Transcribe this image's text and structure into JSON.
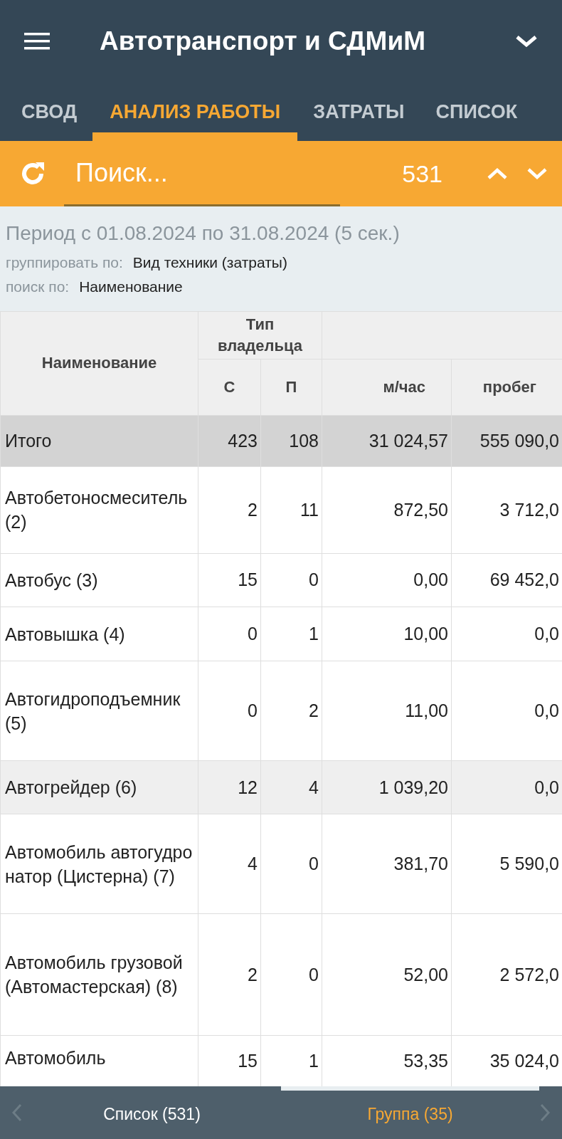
{
  "app_bar": {
    "title": "Автотранспорт и СДМиМ"
  },
  "tabs": [
    {
      "label": "СВОД",
      "selected": false
    },
    {
      "label": "АНАЛИЗ РАБОТЫ",
      "selected": true
    },
    {
      "label": "ЗАТРАТЫ",
      "selected": false
    },
    {
      "label": "СПИСОК",
      "selected": false
    }
  ],
  "search": {
    "placeholder": "Поиск...",
    "count": "531"
  },
  "info": {
    "period": "Период с 01.08.2024 по 31.08.2024 (5 сек.)",
    "group_label": "группировать по:",
    "group_value": "Вид техники (затраты)",
    "search_label": "поиск по:",
    "search_value": "Наименование"
  },
  "table": {
    "header_group": "Тип владельца",
    "columns": [
      "Наименование",
      "С",
      "П",
      "м/час",
      "пробег"
    ],
    "total": {
      "name": "Итого",
      "values": [
        "423",
        "108",
        "31 024,57",
        "555 090,0"
      ]
    },
    "rows": [
      {
        "name": "Автобетоносмеситель (2)",
        "values": [
          "2",
          "11",
          "872,50",
          "3 712,0"
        ],
        "highlighted": false
      },
      {
        "name": "Автобус (3)",
        "values": [
          "15",
          "0",
          "0,00",
          "69 452,0"
        ],
        "highlighted": false
      },
      {
        "name": "Автовышка (4)",
        "values": [
          "0",
          "1",
          "10,00",
          "0,0"
        ],
        "highlighted": false
      },
      {
        "name": "Автогидроподъемник (5)",
        "values": [
          "0",
          "2",
          "11,00",
          "0,0"
        ],
        "highlighted": false
      },
      {
        "name": "Автогрейдер (6)",
        "values": [
          "12",
          "4",
          "1 039,20",
          "0,0"
        ],
        "highlighted": true
      },
      {
        "name": "Автомобиль автогудронатор (Цистерна) (7)",
        "values": [
          "4",
          "0",
          "381,70",
          "5 590,0"
        ],
        "highlighted": false
      },
      {
        "name": "Автомобиль грузовой (Автомастерская) (8)",
        "values": [
          "2",
          "0",
          "52,00",
          "2 572,0"
        ],
        "highlighted": false
      },
      {
        "name": "Автомобиль",
        "values": [
          "15",
          "1",
          "53,35",
          "35 024,0"
        ],
        "highlighted": false
      }
    ]
  },
  "bottom_nav": [
    {
      "label": "Список (531)",
      "selected": false
    },
    {
      "label": "Группа (35)",
      "selected": true
    }
  ]
}
